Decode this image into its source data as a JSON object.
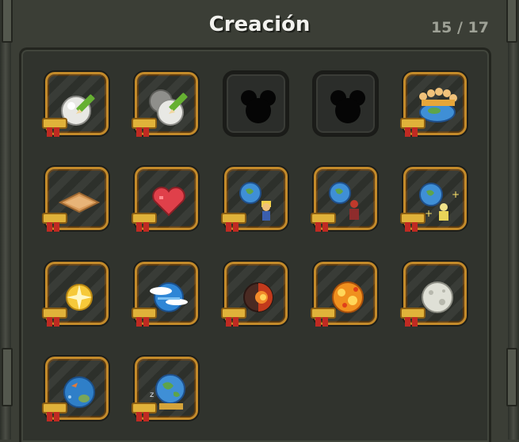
{
  "header": {
    "title": "Creación",
    "counter": "15 / 17"
  },
  "colors": {
    "background": "#3b3e36",
    "panel": "#30332d",
    "slot_border_unlocked": "#c38a2a",
    "slot_border_locked": "#1b1c19",
    "ribbon_gold": "#e0b23a",
    "ribbon_red": "#c02a22"
  },
  "achievements": [
    {
      "icon": "white-ball-pencil-icon",
      "unlocked": true
    },
    {
      "icon": "two-balls-pencil-icon",
      "unlocked": true
    },
    {
      "icon": "locked-silhouette-icon",
      "unlocked": false
    },
    {
      "icon": "locked-silhouette-icon",
      "unlocked": false
    },
    {
      "icon": "crowd-around-planet-icon",
      "unlocked": true
    },
    {
      "icon": "sand-tile-icon",
      "unlocked": true
    },
    {
      "icon": "heart-icon",
      "unlocked": true
    },
    {
      "icon": "planet-with-builder-icon",
      "unlocked": true
    },
    {
      "icon": "planet-with-person-icon",
      "unlocked": true
    },
    {
      "icon": "planet-with-sparkles-icon",
      "unlocked": true
    },
    {
      "icon": "sun-star-icon",
      "unlocked": true
    },
    {
      "icon": "ocean-planet-clouds-icon",
      "unlocked": true
    },
    {
      "icon": "molten-core-icon",
      "unlocked": true
    },
    {
      "icon": "fire-planet-icon",
      "unlocked": true
    },
    {
      "icon": "moon-icon",
      "unlocked": true
    },
    {
      "icon": "water-planet-fish-icon",
      "unlocked": true
    },
    {
      "icon": "sleeping-earth-icon",
      "unlocked": true
    }
  ]
}
